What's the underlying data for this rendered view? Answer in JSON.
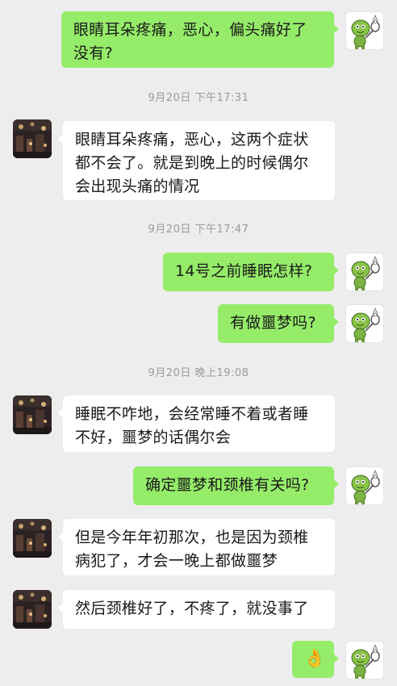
{
  "messages": [
    {
      "sender": "me",
      "text": "眼睛耳朵疼痛，恶心，偏头痛好了没有?"
    },
    {
      "timestamp": "9月20日 下午17:31"
    },
    {
      "sender": "them",
      "text": "眼睛耳朵疼痛，恶心，这两个症状都不会了。就是到晚上的时候偶尔会出现头痛的情况"
    },
    {
      "timestamp": "9月20日 下午17:47"
    },
    {
      "sender": "me",
      "text": "14号之前睡眠怎样?"
    },
    {
      "sender": "me",
      "text": "有做噩梦吗?"
    },
    {
      "timestamp": "9月20日 晚上19:08"
    },
    {
      "sender": "them",
      "text": "睡眠不咋地，会经常睡不着或者睡不好，噩梦的话偶尔会"
    },
    {
      "sender": "me",
      "text": "确定噩梦和颈椎有关吗?"
    },
    {
      "sender": "them",
      "text": "但是今年年初那次，也是因为颈椎病犯了，才会一晚上都做噩梦"
    },
    {
      "sender": "them",
      "text": "然后颈椎好了，不疼了，就没事了"
    },
    {
      "sender": "me",
      "emoji": "👌"
    }
  ],
  "colors": {
    "background": "#ededed",
    "my_bubble": "#95ec69",
    "their_bubble": "#ffffff",
    "timestamp_text": "#9a9a9a"
  },
  "icons": {
    "my_avatar": "cartoon-badminton-avatar-icon",
    "their_avatar": "dark-photo-avatar-icon"
  }
}
